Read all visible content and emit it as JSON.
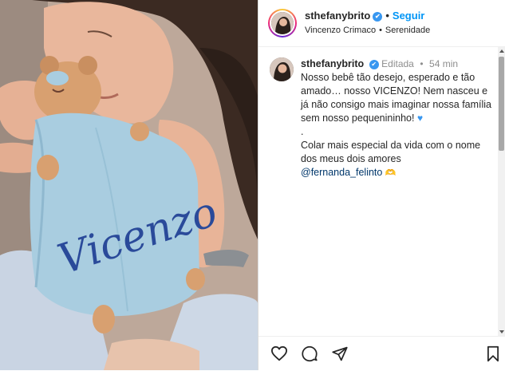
{
  "header": {
    "username": "sthefanybrito",
    "separator": "•",
    "follow_label": "Seguir",
    "audio_artist": "Vincenzo Crimaco",
    "audio_sep": "•",
    "audio_track": "Serenidade"
  },
  "caption": {
    "username": "sthefanybrito",
    "edited_label": "Editada",
    "time_sep": "•",
    "time_ago": "54 min",
    "line1": "Nosso bebê tão desejo, esperado e tão amado… nosso VICENZO! Nem nasceu e já não consigo mais imaginar nossa família sem nosso pequenininho!",
    "dot_line": ".",
    "line2": "Colar mais especial da vida com o nome dos meus dois amores",
    "mention": "@fernanda_felinto"
  },
  "photo": {
    "embroidery_text": "Vicenzo"
  },
  "icons": {
    "verified": "verified-badge-icon",
    "like": "heart-icon",
    "comment": "comment-icon",
    "share": "paper-plane-icon",
    "save": "bookmark-icon"
  },
  "colors": {
    "link_blue": "#0095f6",
    "verified_blue": "#3897f0",
    "mention_navy": "#00376b",
    "blanket_blue": "#a9cde0",
    "embroidery_navy": "#2a4a9a"
  }
}
